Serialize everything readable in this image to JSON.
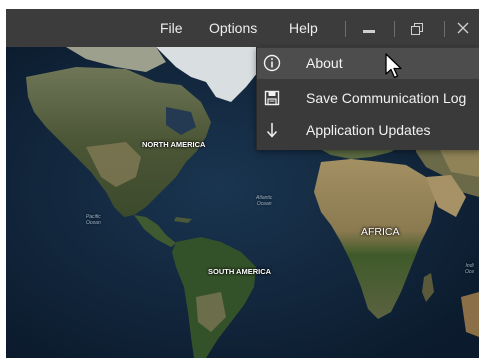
{
  "menubar": {
    "file": "File",
    "options": "Options",
    "help": "Help"
  },
  "window_controls": [
    "minimize-icon",
    "restore-icon",
    "close-icon"
  ],
  "help_menu": {
    "items": [
      {
        "label": "About",
        "icon": "info-icon",
        "highlighted": true
      },
      {
        "label": "Save Communication Log",
        "icon": "save-icon",
        "highlighted": false
      },
      {
        "label": "Application Updates",
        "icon": "download-arrow-icon",
        "highlighted": false
      }
    ]
  },
  "map": {
    "labels": {
      "north_america": "NORTH AMERICA",
      "south_america": "SOUTH AMERICA",
      "africa": "AFRICA",
      "pacific_1": "Pacific",
      "pacific_2": "Ocean",
      "atlantic_1": "Atlantic",
      "atlantic_2": "Ocean",
      "indian_1": "Indi",
      "indian_2": "Oce"
    }
  },
  "colors": {
    "titlebar": "#3c3c3c",
    "menu_background": "#3a3a3a",
    "menu_highlight": "#4d4d4d",
    "ocean": "#10243a",
    "land": "#4b5636"
  }
}
